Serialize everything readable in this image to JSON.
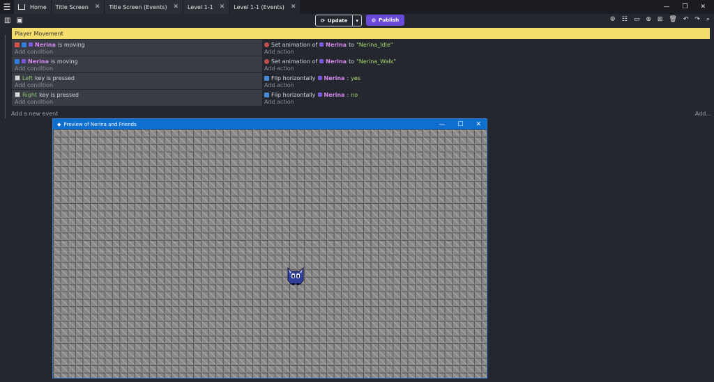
{
  "tabs": [
    {
      "label": "Home",
      "active": false,
      "closable": false
    },
    {
      "label": "Title Screen",
      "active": false,
      "closable": true
    },
    {
      "label": "Title Screen (Events)",
      "active": false,
      "closable": true
    },
    {
      "label": "Level 1-1",
      "active": false,
      "closable": true
    },
    {
      "label": "Level 1-1 (Events)",
      "active": true,
      "closable": true
    }
  ],
  "toolbar": {
    "update_label": "Update",
    "publish_label": "Publish"
  },
  "group": {
    "label": "Player Movement"
  },
  "events": [
    {
      "conditions": [
        {
          "object": "Nerina",
          "text": " is moving"
        }
      ],
      "add_condition": "Add condition",
      "actions": [
        {
          "prefix": "Set animation of ",
          "object": "Nerina",
          "mid": " to ",
          "value": "\"Nerina_Idle\""
        }
      ],
      "add_action": "Add action"
    },
    {
      "conditions": [
        {
          "object": "Nerina",
          "text": " is moving"
        }
      ],
      "add_condition": "Add condition",
      "actions": [
        {
          "prefix": "Set animation of ",
          "object": "Nerina",
          "mid": " to ",
          "value": "\"Nerina_Walk\""
        }
      ],
      "add_action": "Add action"
    },
    {
      "conditions": [
        {
          "key": "Left",
          "text": " key is pressed"
        }
      ],
      "add_condition": "Add condition",
      "actions": [
        {
          "prefix": "Flip horizontally ",
          "object": "Nerina",
          "mid": ": ",
          "value": "yes"
        }
      ],
      "add_action": "Add action"
    },
    {
      "conditions": [
        {
          "key": "Right",
          "text": " key is pressed"
        }
      ],
      "add_condition": "Add condition",
      "actions": [
        {
          "prefix": "Flip horizontally ",
          "object": "Nerina",
          "mid": ": ",
          "value": "no"
        }
      ],
      "add_action": "Add action"
    }
  ],
  "add_event": "Add a new event",
  "add_other": "Add...",
  "preview": {
    "title": "Preview of Nerina and Friends"
  },
  "colors": {
    "accent": "#6a4bd9",
    "group": "#f6de6e",
    "titlebar": "#0e6fcf"
  }
}
